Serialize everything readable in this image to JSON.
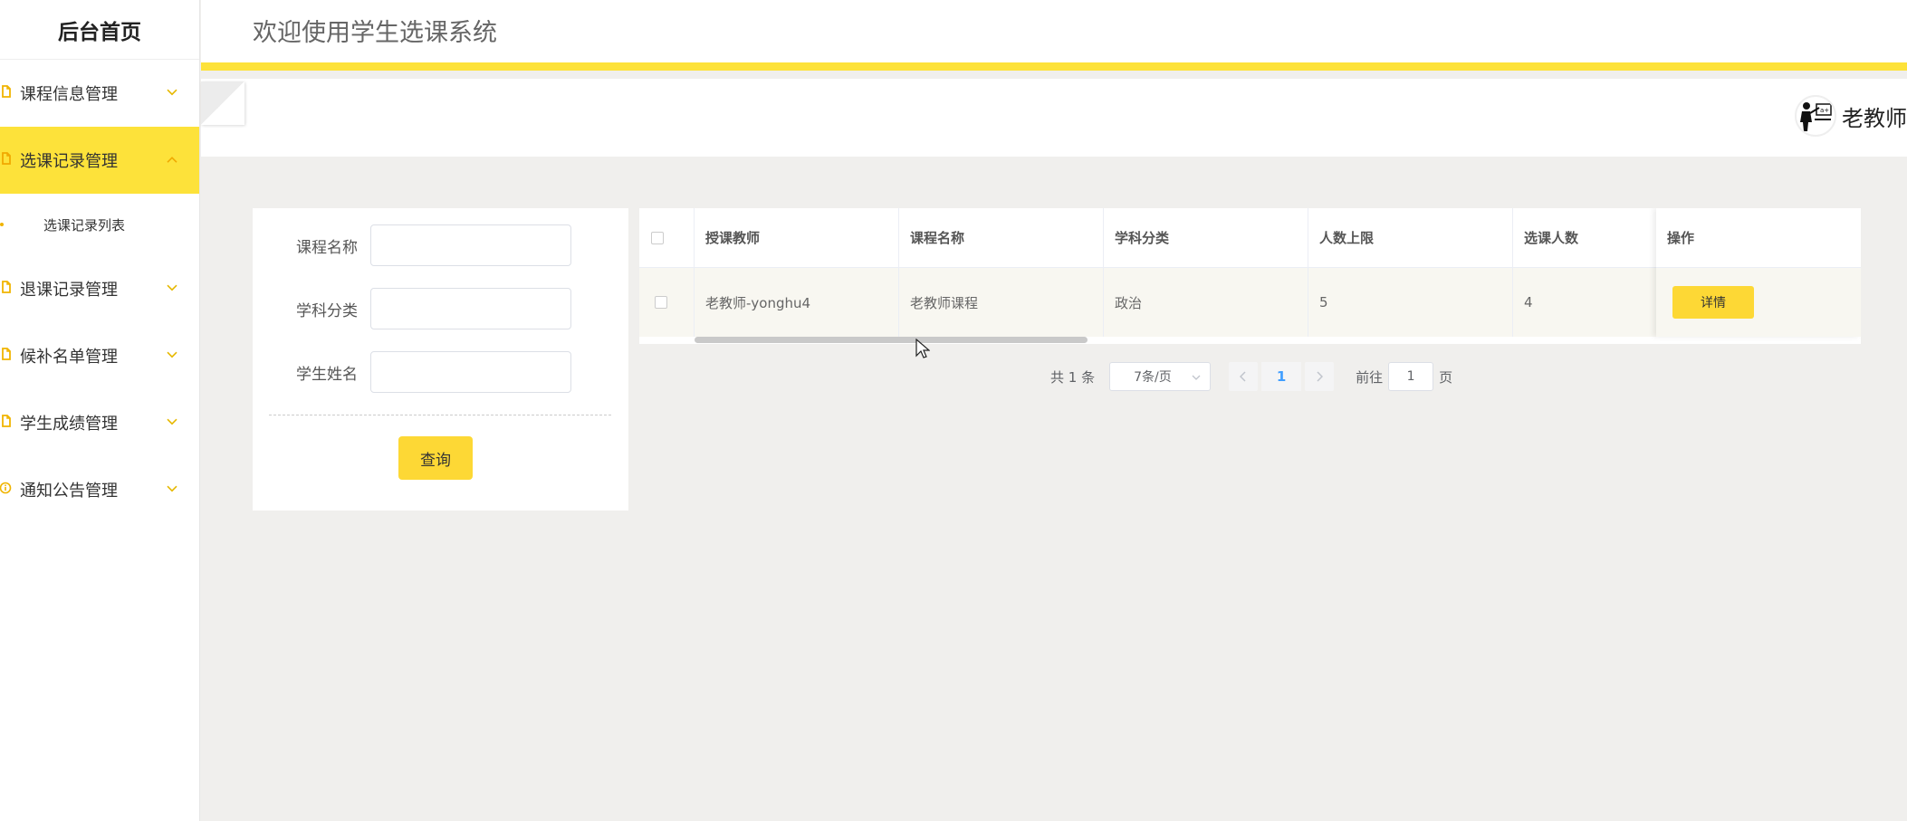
{
  "sidebar": {
    "title": "后台首页",
    "items": [
      {
        "label": "课程信息管理",
        "icon": "mobile-icon",
        "expanded": false
      },
      {
        "label": "选课记录管理",
        "icon": "mobile-icon",
        "expanded": true,
        "active": true,
        "children": [
          {
            "label": "选课记录列表"
          }
        ]
      },
      {
        "label": "退课记录管理",
        "icon": "mobile-icon",
        "expanded": false
      },
      {
        "label": "候补名单管理",
        "icon": "mobile-icon",
        "expanded": false
      },
      {
        "label": "学生成绩管理",
        "icon": "mobile-icon",
        "expanded": false
      },
      {
        "label": "通知公告管理",
        "icon": "info-icon",
        "expanded": false
      }
    ]
  },
  "header": {
    "title": "欢迎使用学生选课系统",
    "accent_color": "#fde23a"
  },
  "user": {
    "name": "老教师",
    "avatar_icon": "teacher-avatar-icon"
  },
  "search": {
    "fields": [
      {
        "label": "课程名称",
        "value": ""
      },
      {
        "label": "学科分类",
        "value": ""
      },
      {
        "label": "学生姓名",
        "value": ""
      }
    ],
    "query_button": "查询"
  },
  "table": {
    "columns": [
      "授课教师",
      "课程名称",
      "学科分类",
      "人数上限",
      "选课人数",
      "操作"
    ],
    "rows": [
      {
        "teacher": "老教师-yonghu4",
        "course": "老教师课程",
        "category": "政治",
        "limit": "5",
        "enrolled": "4",
        "action": "详情"
      }
    ]
  },
  "pagination": {
    "total_text": "共 1 条",
    "page_size": "7条/页",
    "current_page": "1",
    "goto_label": "前往",
    "goto_value": "1",
    "page_suffix": "页"
  }
}
